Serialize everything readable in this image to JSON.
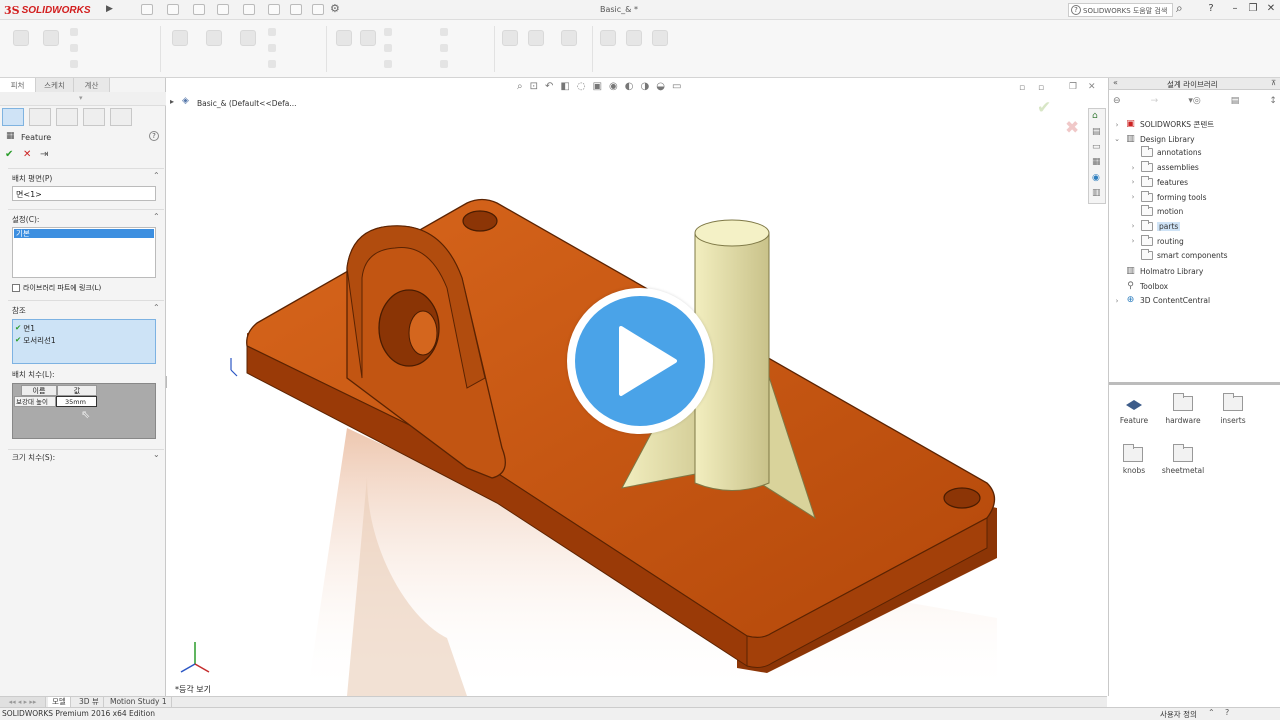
{
  "app": {
    "brand_ds": "3S",
    "brand_name": "SOLIDWORKS",
    "document_title": "Basic_& *",
    "search_placeholder": "SOLIDWORKS 도움말 검색"
  },
  "left_panel": {
    "tabs": [
      "피처",
      "스케치",
      "계산"
    ],
    "property_title": "Feature",
    "placement_plane": {
      "label": "배치 평면(P)",
      "value": "면<1>"
    },
    "configuration": {
      "label": "설정(C):",
      "selected": "기본",
      "checkbox_label": "라이브러리 파트에 링크(L)"
    },
    "references": {
      "label": "참조",
      "items": [
        "면1",
        "모서리선1"
      ]
    },
    "placement_dims": {
      "label": "배치 치수(L):",
      "col_name": "이름",
      "col_value": "값",
      "row_name": "보강대 높이",
      "row_value": "35mm"
    },
    "size_dims": {
      "label": "크기 치수(S):"
    }
  },
  "viewport": {
    "breadcrumb": "Basic_&  (Default<<Defa...",
    "view_label": "*등각 보기"
  },
  "design_library": {
    "title": "설계 라이브러리",
    "tree": [
      {
        "label": "SOLIDWORKS 콘텐트",
        "level": 0,
        "expand": "›"
      },
      {
        "label": "Design Library",
        "level": 0,
        "expand": "⌄"
      },
      {
        "label": "annotations",
        "level": 1,
        "expand": ""
      },
      {
        "label": "assemblies",
        "level": 1,
        "expand": "›"
      },
      {
        "label": "features",
        "level": 1,
        "expand": "›"
      },
      {
        "label": "forming tools",
        "level": 1,
        "expand": "›"
      },
      {
        "label": "motion",
        "level": 1,
        "expand": ""
      },
      {
        "label": "parts",
        "level": 1,
        "expand": "›"
      },
      {
        "label": "routing",
        "level": 1,
        "expand": "›"
      },
      {
        "label": "smart components",
        "level": 1,
        "expand": ""
      },
      {
        "label": "Holmatro Library",
        "level": 0,
        "expand": ""
      },
      {
        "label": "Toolbox",
        "level": 0,
        "expand": ""
      },
      {
        "label": "3D ContentCentral",
        "level": 0,
        "expand": "›"
      }
    ],
    "folders": [
      "Feature",
      "hardware",
      "inserts",
      "knobs",
      "sheetmetal"
    ]
  },
  "bottom_tabs": [
    "모델",
    "3D 뷰",
    "Motion Study 1"
  ],
  "status": {
    "left": "SOLIDWORKS Premium 2016 x64 Edition",
    "right": "사용자 정의"
  },
  "colors": {
    "part": "#c4520c",
    "rib": "#ebe6a8",
    "play": "#4aa3e8",
    "accent": "#2b79c9"
  }
}
